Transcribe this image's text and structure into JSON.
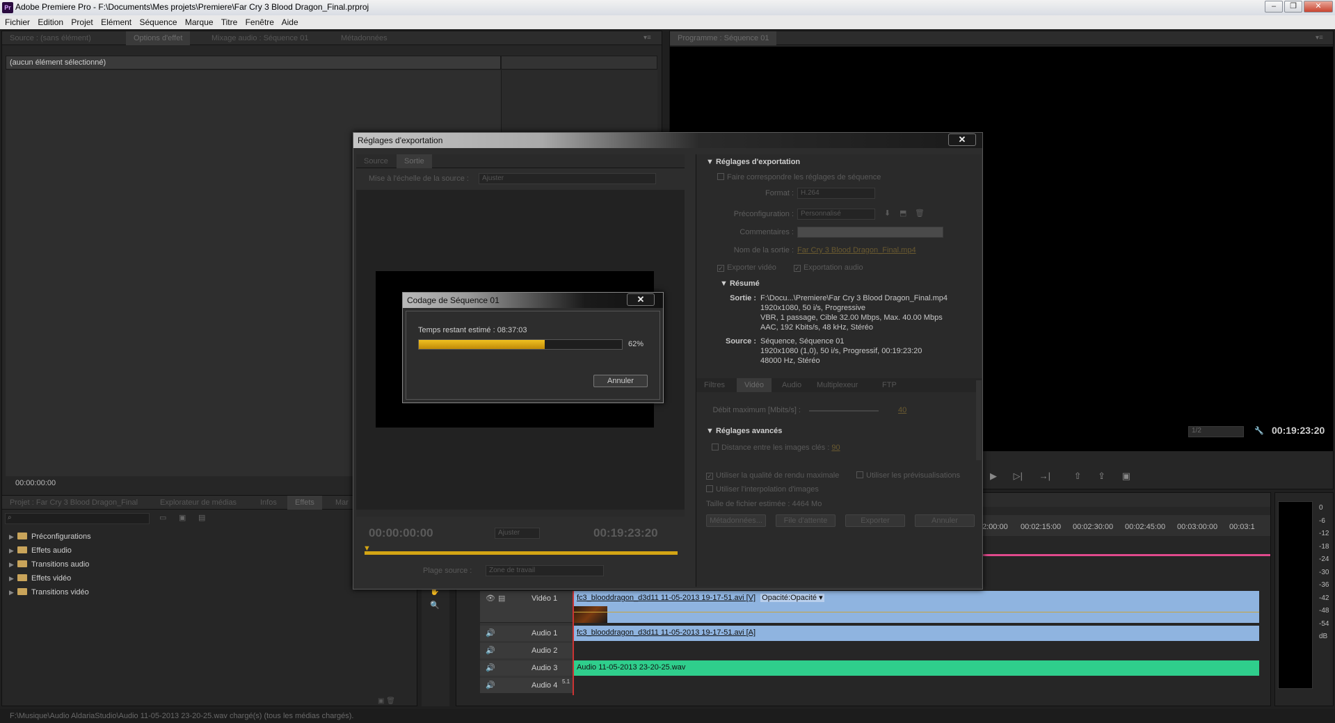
{
  "window": {
    "title": "Adobe Premiere Pro - F:\\Documents\\Mes projets\\Premiere\\Far Cry 3 Blood Dragon_Final.prproj",
    "logo": "Pr"
  },
  "menu": [
    "Fichier",
    "Edition",
    "Projet",
    "Elément",
    "Séquence",
    "Marque",
    "Titre",
    "Fenêtre",
    "Aide"
  ],
  "source_panel": {
    "tabs": [
      "Source : (sans élément)",
      "Options d'effet",
      "Mixage audio : Séquence 01",
      "Métadonnées"
    ],
    "no_selection": "(aucun élément sélectionné)",
    "timecode": "00:00:00:00"
  },
  "program_panel": {
    "tab": "Programme : Séquence 01",
    "zoom": "1/2",
    "timecode": "00:19:23:20"
  },
  "project_panel": {
    "tabs": [
      "Projet : Far Cry 3 Blood Dragon_Final",
      "Explorateur de médias",
      "Infos",
      "Effets",
      "Mar"
    ],
    "tree": [
      "Préconfigurations",
      "Effets audio",
      "Transitions audio",
      "Effets vidéo",
      "Transitions vidéo"
    ]
  },
  "timeline": {
    "ruler": [
      "2:00:00",
      "00:02:15:00",
      "00:02:30:00",
      "00:02:45:00",
      "00:03:00:00",
      "00:03:1"
    ],
    "tracks": [
      {
        "name": "Vidéo 1",
        "clip": "fc3_blooddragon_d3d11 11-05-2013 19-17-51.avi [V]",
        "extra": "Opacité:Opacité ▾"
      },
      {
        "name": "Audio 1",
        "clip": "fc3_blooddragon_d3d11 11-05-2013 19-17-51.avi [A]"
      },
      {
        "name": "Audio 2",
        "clip": ""
      },
      {
        "name": "Audio 3",
        "clip": "Audio 11-05-2013 23-20-25.wav"
      },
      {
        "name": "Audio 4",
        "clip": "",
        "badge": "5.1"
      }
    ]
  },
  "meter_scale": [
    "0",
    "-6",
    "-12",
    "-18",
    "-24",
    "-30",
    "-36",
    "-42",
    "-48",
    "-54",
    "dB"
  ],
  "export_dialog": {
    "title": "Réglages d'exportation",
    "close": "✕",
    "left_tabs": [
      "Source",
      "Sortie"
    ],
    "scale_label": "Mise à l'échelle de la source :",
    "scale_value": "Ajuster",
    "tc_start": "00:00:00:00",
    "tc_end": "00:19:23:20",
    "fit": "Ajuster",
    "range_label": "Plage source :",
    "range_value": "Zone de travail",
    "settings": {
      "header": "Réglages d'exportation",
      "match": "Faire correspondre les réglages de séquence",
      "format_label": "Format :",
      "format_value": "H.264",
      "preset_label": "Préconfiguration :",
      "preset_value": "Personnalisé",
      "comments_label": "Commentaires :",
      "output_label": "Nom de la sortie :",
      "output_value": "Far Cry 3 Blood Dragon_Final.mp4",
      "export_video": "Exporter vidéo",
      "export_audio": "Exportation audio"
    },
    "summary": {
      "header": "Résumé",
      "output_label": "Sortie :",
      "output_lines": [
        "F:\\Docu...\\Premiere\\Far Cry 3 Blood Dragon_Final.mp4",
        "1920x1080, 50 i/s, Progressive",
        "VBR, 1 passage, Cible 32.00 Mbps, Max. 40.00 Mbps",
        "AAC, 192  Kbits/s, 48  kHz, Stéréo"
      ],
      "source_label": "Source :",
      "source_lines": [
        "Séquence, Séquence 01",
        "1920x1080 (1,0), 50  i/s, Progressif, 00:19:23:20",
        "48000 Hz, Stéréo"
      ]
    },
    "right_tabs": [
      "Filtres",
      "Vidéo",
      "Audio",
      "Multiplexeur",
      "FTP"
    ],
    "max_bitrate_label": "Débit maximum [Mbits/s] :",
    "max_bitrate_value": "40",
    "advanced_header": "Réglages avancés",
    "keyframe_label": "Distance entre les images clés :",
    "keyframe_value": "90",
    "max_quality": "Utiliser la qualité de rendu maximale",
    "use_previews": "Utiliser les prévisualisations",
    "interp": "Utiliser l'interpolation d'images",
    "filesize": "Taille de fichier estimée : 4464 Mo",
    "btn_metadata": "Métadonnées...",
    "btn_queue": "File d'attente",
    "btn_export": "Exporter",
    "btn_cancel": "Annuler"
  },
  "encode_dialog": {
    "title": "Codage de Séquence 01",
    "close": "✕",
    "remaining": "Temps restant estimé : 08:37:03",
    "progress": 0.62,
    "percent": "62%",
    "cancel": "Annuler"
  },
  "status": "F:\\Musique\\Audio AldariaStudio\\Audio 11-05-2013 23-20-25.wav chargé(s) (tous les médias chargés)."
}
